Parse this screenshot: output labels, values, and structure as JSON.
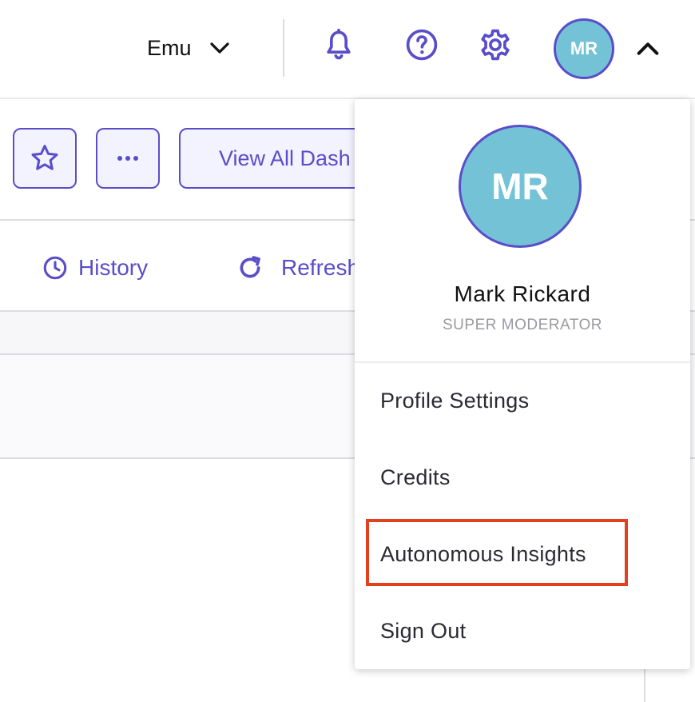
{
  "header": {
    "workspace_label": "Emu",
    "avatar_initials": "MR"
  },
  "toolbar": {
    "view_all_label": "View All Dash"
  },
  "subbar": {
    "history_label": "History",
    "refresh_label": "Refresh"
  },
  "user_menu": {
    "avatar_initials": "MR",
    "user_name": "Mark Rickard",
    "user_role": "SUPER MODERATOR",
    "items": [
      {
        "label": "Profile Settings"
      },
      {
        "label": "Credits"
      },
      {
        "label": "Autonomous Insights"
      },
      {
        "label": "Sign Out"
      }
    ]
  },
  "colors": {
    "accent": "#5a4dc9",
    "avatar_bg": "#74c2d6",
    "highlight": "#e2401f"
  }
}
